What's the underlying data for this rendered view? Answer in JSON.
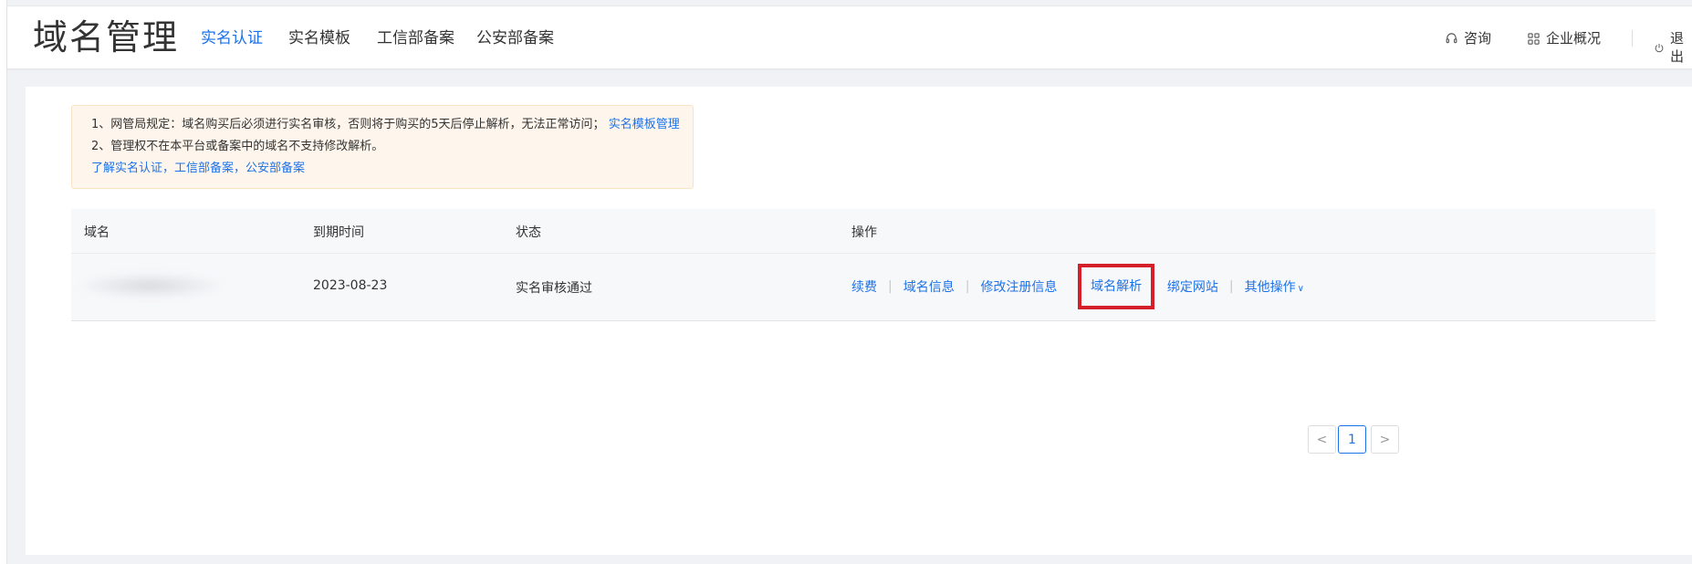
{
  "app": {
    "title": "域名管理"
  },
  "nav": [
    {
      "label": "实名认证",
      "active": true
    },
    {
      "label": "实名模板",
      "active": false
    },
    {
      "label": "工信部备案",
      "active": false
    },
    {
      "label": "公安部备案",
      "active": false
    }
  ],
  "header_tools": {
    "consult": "咨询",
    "overview": "企业概况",
    "logout": "退出"
  },
  "notice": {
    "line1": "1、网管局规定：域名购买后必须进行实名审核，否则将于购买的5天后停止解析，无法正常访问；",
    "line1_link": "实名模板管理",
    "line2": "2、管理权不在本平台或备案中的域名不支持修改解析。",
    "line3_link": "了解实名认证，工信部备案，公安部备案"
  },
  "table": {
    "columns": [
      "域名",
      "到期时间",
      "状态",
      "操作"
    ],
    "rows": [
      {
        "domain": "",
        "expiry": "2023-08-23",
        "status": "实名审核通过",
        "actions": [
          "续费",
          "域名信息",
          "修改注册信息",
          "域名解析",
          "绑定网站",
          "其他操作"
        ]
      }
    ]
  },
  "pagination": {
    "prev": "<",
    "current": "1",
    "next": ">"
  },
  "colors": {
    "accent": "#1e72e8",
    "highlight_box": "#d51f2a",
    "notice_bg": "#fef6ec"
  },
  "icons": {
    "consult": "headset-icon",
    "overview": "grid-icon",
    "logout": "power-icon",
    "more": "chevron-down-icon"
  }
}
